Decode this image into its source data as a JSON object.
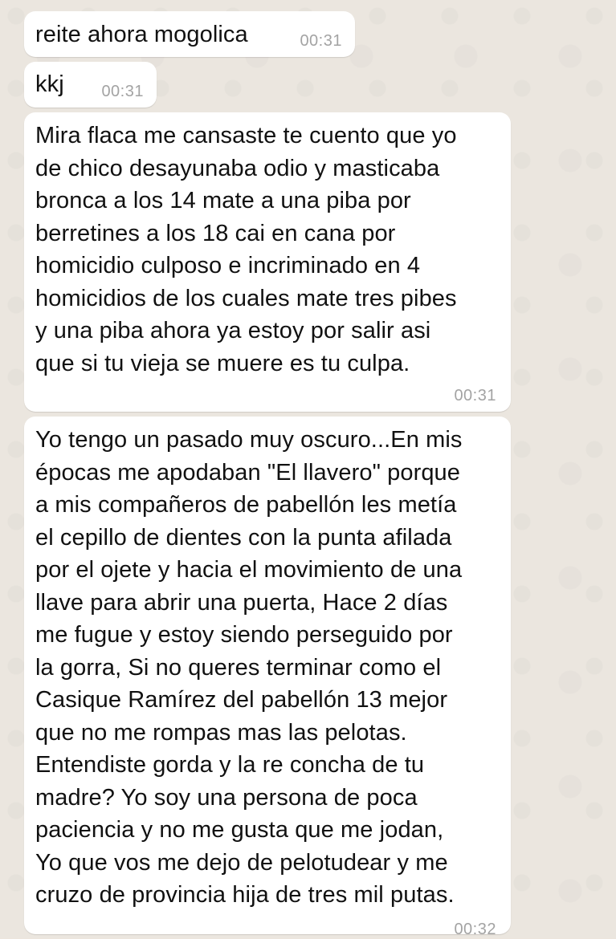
{
  "messages": [
    {
      "text": "reite ahora mogolica",
      "time": "00:31"
    },
    {
      "text": "kkj",
      "time": "00:31"
    },
    {
      "text": "Mira flaca me cansaste te cuento que yo\nde chico desayunaba odio y masticaba\nbronca a los 14 mate a una piba por\nberretines a los 18 cai en cana por\nhomicidio culposo e incriminado en 4\nhomicidios de los cuales mate tres pibes\ny una piba ahora ya estoy por salir asi\nque si tu vieja se muere es tu culpa.",
      "time": "00:31"
    },
    {
      "text": "Yo tengo un pasado muy oscuro...En mis\népocas me apodaban \"El llavero\" porque\na mis compañeros de pabellón les metía\nel cepillo de dientes con la punta afilada\npor el ojete y hacia el movimiento de una\nllave para abrir una puerta, Hace 2 días\nme fugue y estoy siendo perseguido por\nla gorra, Si no queres terminar como el\nCasique Ramírez del pabellón 13 mejor\nque no me rompas mas las pelotas.\nEntendiste gorda y la re concha de tu\nmadre? Yo soy una persona de poca\npaciencia y no me gusta que me jodan,\nYo que vos me dejo de pelotudear y me\ncruzo de provincia hija de tres mil putas.",
      "time": "00:32"
    }
  ]
}
